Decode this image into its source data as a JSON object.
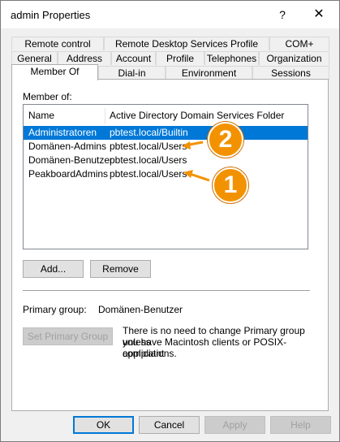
{
  "window": {
    "title": "admin Properties",
    "help_glyph": "?",
    "close_glyph": "✕"
  },
  "tabs": {
    "row1": [
      "Remote control",
      "Remote Desktop Services Profile",
      "COM+"
    ],
    "row2": [
      "General",
      "Address",
      "Account",
      "Profile",
      "Telephones",
      "Organization"
    ],
    "row3": [
      "Member Of",
      "Dial-in",
      "Environment",
      "Sessions"
    ],
    "selected": "Member Of"
  },
  "member_of": {
    "label": "Member of:",
    "columns": [
      "Name",
      "Active Directory Domain Services Folder"
    ],
    "rows": [
      {
        "name": "Administratoren",
        "folder": "pbtest.local/Builtin",
        "selected": true
      },
      {
        "name": "Domänen-Admins",
        "folder": "pbtest.local/Users",
        "selected": false
      },
      {
        "name": "Domänen-Benutzer",
        "folder": "pbtest.local/Users",
        "selected": false
      },
      {
        "name": "PeakboardAdmins",
        "folder": "pbtest.local/Users",
        "selected": false
      }
    ],
    "add_label": "Add...",
    "remove_label": "Remove"
  },
  "primary_group": {
    "label": "Primary group:",
    "value": "Domänen-Benutzer",
    "set_button": "Set Primary Group",
    "note_line1": "There is no need to change Primary group unless",
    "note_line2": "you have Macintosh clients or POSIX-compliant",
    "note_line3": "applications."
  },
  "callouts": {
    "one": "1",
    "two": "2",
    "color": "#f39200"
  },
  "footer": {
    "ok": "OK",
    "cancel": "Cancel",
    "apply": "Apply",
    "help": "Help"
  },
  "colors": {
    "selection": "#0078d7"
  }
}
